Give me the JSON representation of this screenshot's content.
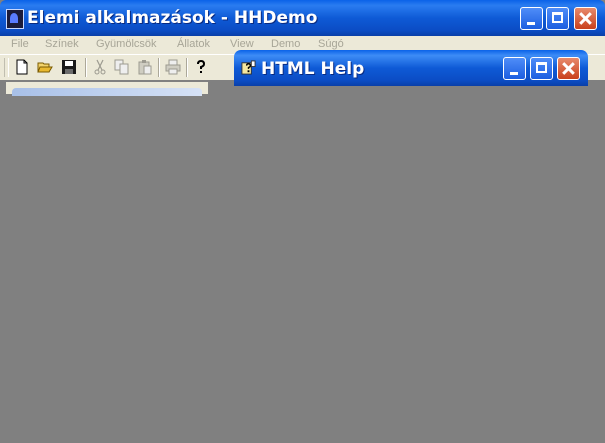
{
  "main_window": {
    "title": "Elemi alkalmazások - HHDemo",
    "menu": [
      "File",
      "Színek",
      "Gyümölcsök",
      "Állatok",
      "View",
      "Demo",
      "Súgó"
    ]
  },
  "toolbar": {
    "icons": [
      "new-icon",
      "open-icon",
      "save-icon",
      "cut-icon",
      "copy-icon",
      "paste-icon",
      "print-icon",
      "help-icon"
    ]
  },
  "help_window": {
    "title": "HTML Help"
  },
  "colors": {
    "titlebar": "#0b4cc4",
    "menubar": "#ece9d8",
    "menu_disabled_text": "#a7a597",
    "workspace": "#808080",
    "close_button": "#c9401c"
  }
}
